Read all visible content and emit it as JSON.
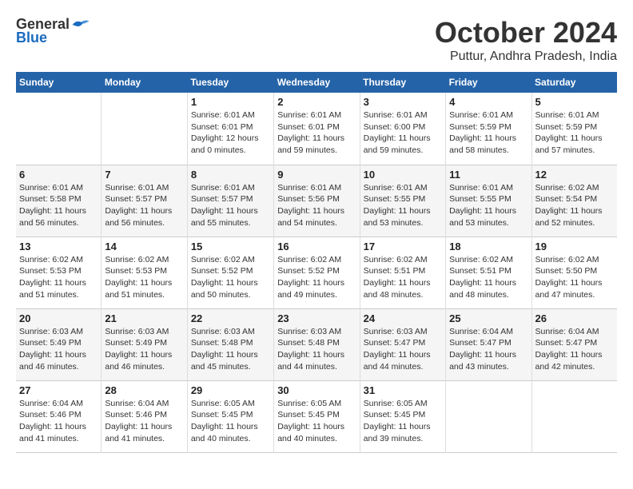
{
  "logo": {
    "general": "General",
    "blue": "Blue"
  },
  "title": "October 2024",
  "location": "Puttur, Andhra Pradesh, India",
  "headers": [
    "Sunday",
    "Monday",
    "Tuesday",
    "Wednesday",
    "Thursday",
    "Friday",
    "Saturday"
  ],
  "weeks": [
    [
      {
        "day": "",
        "info": ""
      },
      {
        "day": "",
        "info": ""
      },
      {
        "day": "1",
        "info": "Sunrise: 6:01 AM\nSunset: 6:01 PM\nDaylight: 12 hours\nand 0 minutes."
      },
      {
        "day": "2",
        "info": "Sunrise: 6:01 AM\nSunset: 6:01 PM\nDaylight: 11 hours\nand 59 minutes."
      },
      {
        "day": "3",
        "info": "Sunrise: 6:01 AM\nSunset: 6:00 PM\nDaylight: 11 hours\nand 59 minutes."
      },
      {
        "day": "4",
        "info": "Sunrise: 6:01 AM\nSunset: 5:59 PM\nDaylight: 11 hours\nand 58 minutes."
      },
      {
        "day": "5",
        "info": "Sunrise: 6:01 AM\nSunset: 5:59 PM\nDaylight: 11 hours\nand 57 minutes."
      }
    ],
    [
      {
        "day": "6",
        "info": "Sunrise: 6:01 AM\nSunset: 5:58 PM\nDaylight: 11 hours\nand 56 minutes."
      },
      {
        "day": "7",
        "info": "Sunrise: 6:01 AM\nSunset: 5:57 PM\nDaylight: 11 hours\nand 56 minutes."
      },
      {
        "day": "8",
        "info": "Sunrise: 6:01 AM\nSunset: 5:57 PM\nDaylight: 11 hours\nand 55 minutes."
      },
      {
        "day": "9",
        "info": "Sunrise: 6:01 AM\nSunset: 5:56 PM\nDaylight: 11 hours\nand 54 minutes."
      },
      {
        "day": "10",
        "info": "Sunrise: 6:01 AM\nSunset: 5:55 PM\nDaylight: 11 hours\nand 53 minutes."
      },
      {
        "day": "11",
        "info": "Sunrise: 6:01 AM\nSunset: 5:55 PM\nDaylight: 11 hours\nand 53 minutes."
      },
      {
        "day": "12",
        "info": "Sunrise: 6:02 AM\nSunset: 5:54 PM\nDaylight: 11 hours\nand 52 minutes."
      }
    ],
    [
      {
        "day": "13",
        "info": "Sunrise: 6:02 AM\nSunset: 5:53 PM\nDaylight: 11 hours\nand 51 minutes."
      },
      {
        "day": "14",
        "info": "Sunrise: 6:02 AM\nSunset: 5:53 PM\nDaylight: 11 hours\nand 51 minutes."
      },
      {
        "day": "15",
        "info": "Sunrise: 6:02 AM\nSunset: 5:52 PM\nDaylight: 11 hours\nand 50 minutes."
      },
      {
        "day": "16",
        "info": "Sunrise: 6:02 AM\nSunset: 5:52 PM\nDaylight: 11 hours\nand 49 minutes."
      },
      {
        "day": "17",
        "info": "Sunrise: 6:02 AM\nSunset: 5:51 PM\nDaylight: 11 hours\nand 48 minutes."
      },
      {
        "day": "18",
        "info": "Sunrise: 6:02 AM\nSunset: 5:51 PM\nDaylight: 11 hours\nand 48 minutes."
      },
      {
        "day": "19",
        "info": "Sunrise: 6:02 AM\nSunset: 5:50 PM\nDaylight: 11 hours\nand 47 minutes."
      }
    ],
    [
      {
        "day": "20",
        "info": "Sunrise: 6:03 AM\nSunset: 5:49 PM\nDaylight: 11 hours\nand 46 minutes."
      },
      {
        "day": "21",
        "info": "Sunrise: 6:03 AM\nSunset: 5:49 PM\nDaylight: 11 hours\nand 46 minutes."
      },
      {
        "day": "22",
        "info": "Sunrise: 6:03 AM\nSunset: 5:48 PM\nDaylight: 11 hours\nand 45 minutes."
      },
      {
        "day": "23",
        "info": "Sunrise: 6:03 AM\nSunset: 5:48 PM\nDaylight: 11 hours\nand 44 minutes."
      },
      {
        "day": "24",
        "info": "Sunrise: 6:03 AM\nSunset: 5:47 PM\nDaylight: 11 hours\nand 44 minutes."
      },
      {
        "day": "25",
        "info": "Sunrise: 6:04 AM\nSunset: 5:47 PM\nDaylight: 11 hours\nand 43 minutes."
      },
      {
        "day": "26",
        "info": "Sunrise: 6:04 AM\nSunset: 5:47 PM\nDaylight: 11 hours\nand 42 minutes."
      }
    ],
    [
      {
        "day": "27",
        "info": "Sunrise: 6:04 AM\nSunset: 5:46 PM\nDaylight: 11 hours\nand 41 minutes."
      },
      {
        "day": "28",
        "info": "Sunrise: 6:04 AM\nSunset: 5:46 PM\nDaylight: 11 hours\nand 41 minutes."
      },
      {
        "day": "29",
        "info": "Sunrise: 6:05 AM\nSunset: 5:45 PM\nDaylight: 11 hours\nand 40 minutes."
      },
      {
        "day": "30",
        "info": "Sunrise: 6:05 AM\nSunset: 5:45 PM\nDaylight: 11 hours\nand 40 minutes."
      },
      {
        "day": "31",
        "info": "Sunrise: 6:05 AM\nSunset: 5:45 PM\nDaylight: 11 hours\nand 39 minutes."
      },
      {
        "day": "",
        "info": ""
      },
      {
        "day": "",
        "info": ""
      }
    ]
  ]
}
